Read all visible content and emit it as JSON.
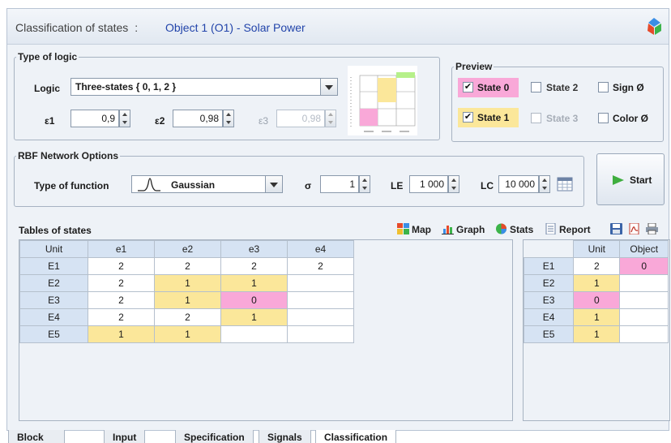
{
  "header": {
    "title": "Classification of states",
    "separator": ":",
    "object": "Object 1 (O1) - Solar Power"
  },
  "logic_panel": {
    "legend": "Type of logic",
    "logic_label": "Logic",
    "logic_value": "Three-states { 0, 1, 2 }",
    "eps1_label": "ε1",
    "eps1_value": "0,9",
    "eps2_label": "ε2",
    "eps2_value": "0,98",
    "eps3_label": "ε3",
    "eps3_value": "0,98"
  },
  "preview_panel": {
    "legend": "Preview",
    "state0": "State 0",
    "state1": "State 1",
    "state2": "State 2",
    "state3": "State 3",
    "sign": "Sign Ø",
    "color": "Color Ø"
  },
  "rbf_panel": {
    "legend": "RBF Network Options",
    "type_label": "Type of function",
    "type_value": "Gaussian",
    "sigma_label": "σ",
    "sigma_value": "1",
    "le_label": "LE",
    "le_value": "1 000",
    "lc_label": "LC",
    "lc_value": "10 000"
  },
  "start_label": "Start",
  "tables": {
    "title": "Tables of states",
    "toolbar": {
      "map": "Map",
      "graph": "Graph",
      "stats": "Stats",
      "report": "Report"
    },
    "left_headers": [
      "Unit",
      "e1",
      "e2",
      "e3",
      "e4"
    ],
    "left_rows": [
      [
        "E1",
        "2",
        "2",
        "2",
        "2"
      ],
      [
        "E2",
        "2",
        "1",
        "1",
        ""
      ],
      [
        "E3",
        "2",
        "1",
        "0",
        ""
      ],
      [
        "E4",
        "2",
        "2",
        "1",
        ""
      ],
      [
        "E5",
        "1",
        "1",
        "",
        ""
      ]
    ],
    "right_headers": [
      "",
      "Unit",
      "Object"
    ],
    "right_rows": [
      [
        "E1",
        "2",
        "0"
      ],
      [
        "E2",
        "1",
        ""
      ],
      [
        "E3",
        "0",
        ""
      ],
      [
        "E4",
        "1",
        ""
      ],
      [
        "E5",
        "1",
        ""
      ]
    ]
  },
  "tabs": [
    "Block Diagram",
    "Input Data",
    "Specification",
    "Signals",
    "Classification"
  ],
  "colors": {
    "state0": "#f9a8d8",
    "state1": "#fbe79a",
    "header": "#d6e3f3",
    "object_title": "#2244aa"
  }
}
